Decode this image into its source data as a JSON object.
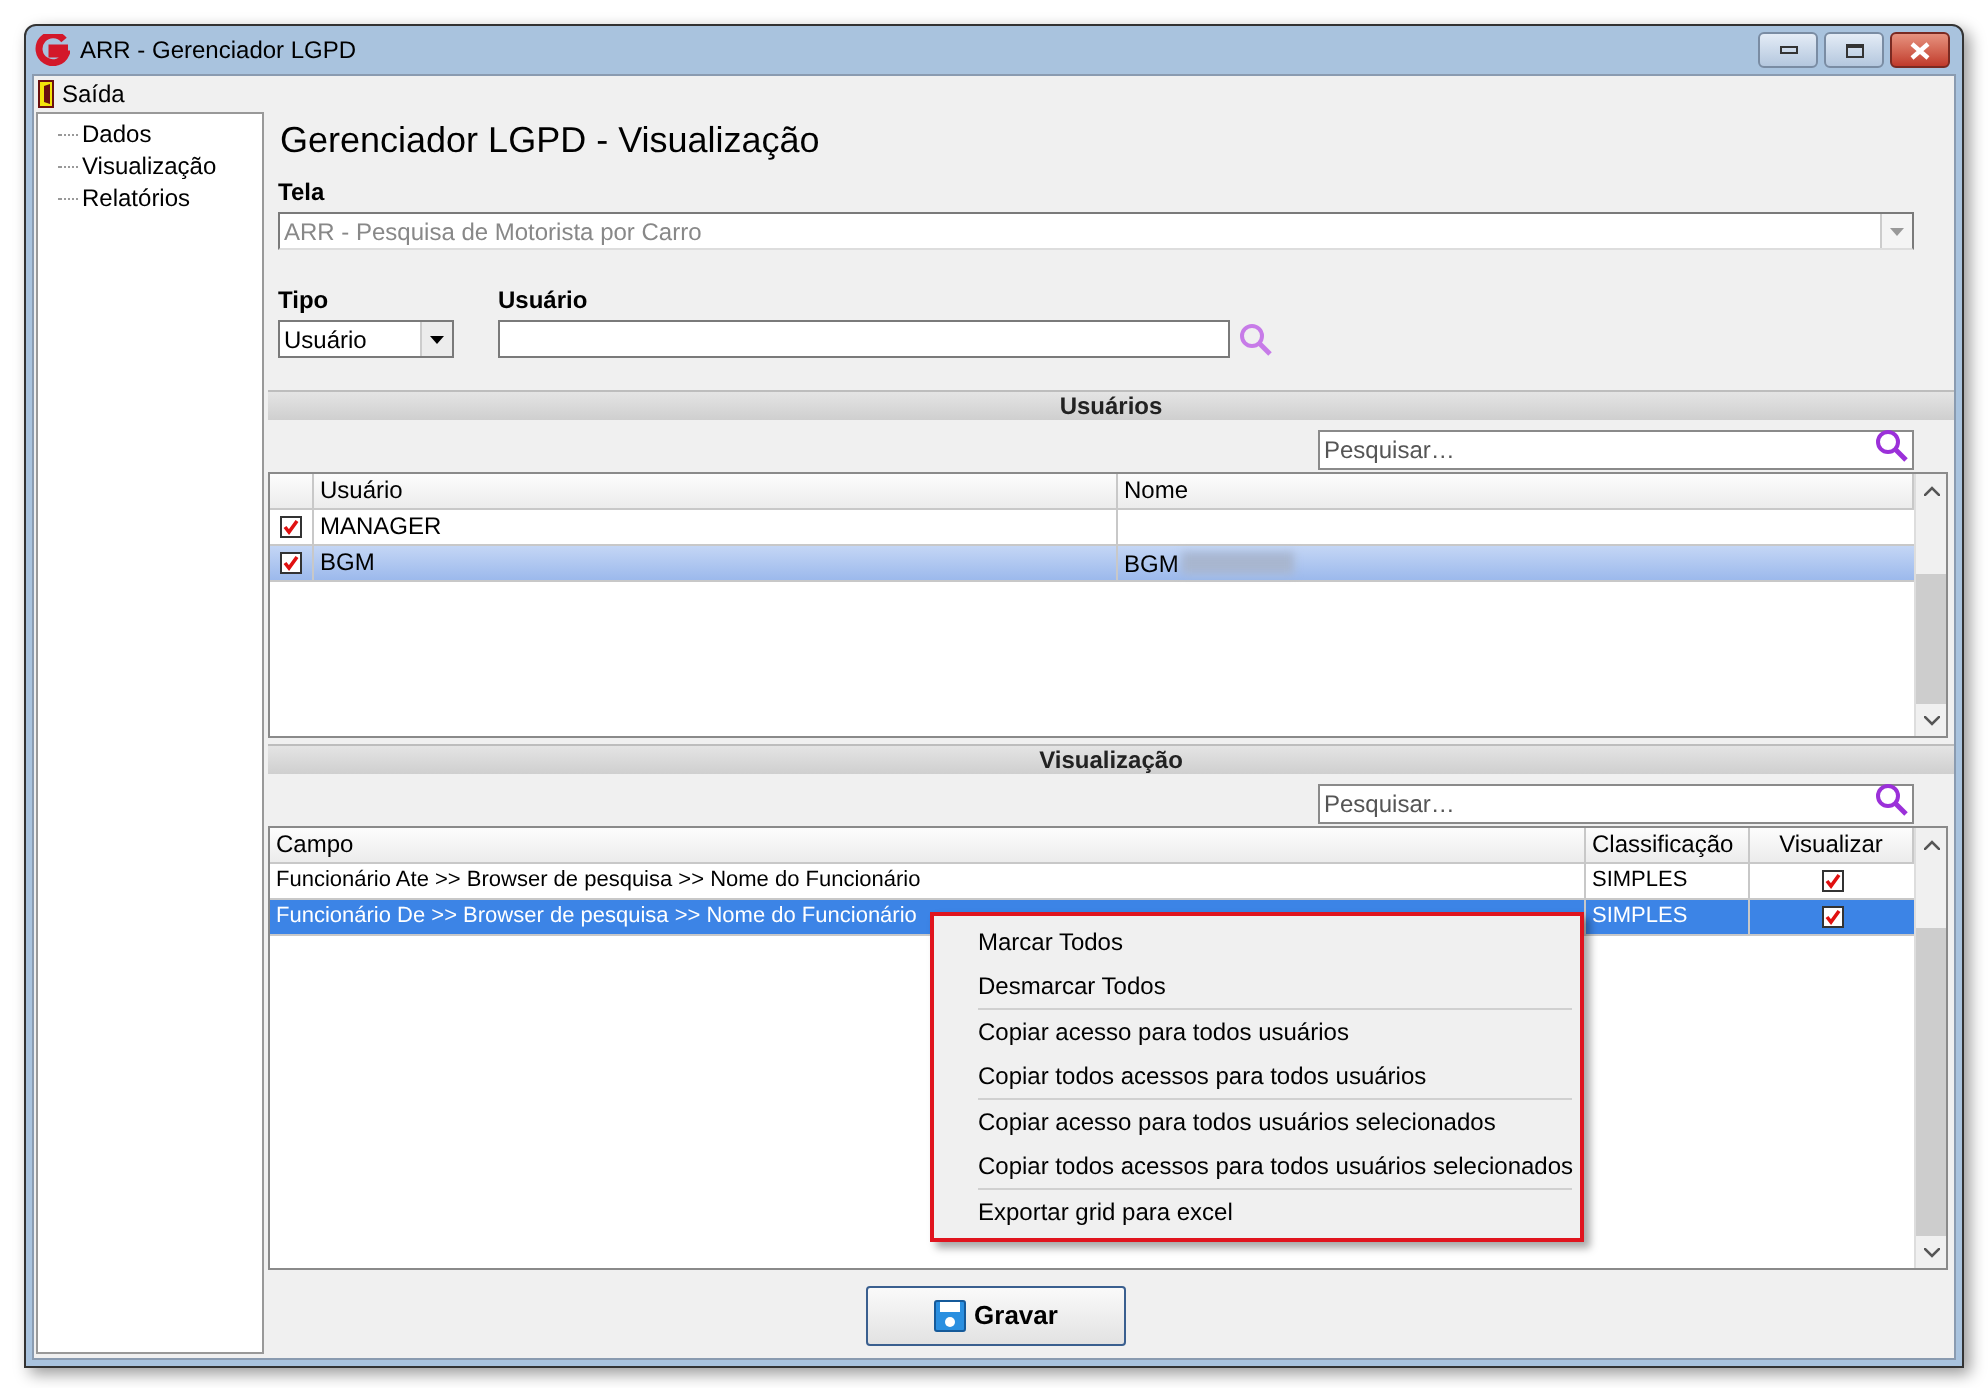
{
  "window": {
    "title": "ARR - Gerenciador LGPD"
  },
  "menu": [
    {
      "label": "Saída"
    }
  ],
  "sidebar": {
    "items": [
      {
        "label": "Dados"
      },
      {
        "label": "Visualização"
      },
      {
        "label": "Relatórios"
      }
    ]
  },
  "heading": "Gerenciador LGPD - Visualização",
  "tela": {
    "label": "Tela",
    "value": "ARR - Pesquisa de Motorista por Carro",
    "disabled": true
  },
  "tipo": {
    "label": "Tipo",
    "value": "Usuário"
  },
  "usuario": {
    "label": "Usuário"
  },
  "users": {
    "title": "Usuários",
    "search": {
      "placeholder": "Pesquisar…"
    },
    "columns": [
      "Usuário",
      "Nome"
    ],
    "rows": [
      {
        "checked": true,
        "usuario": "MANAGER",
        "selected": false
      },
      {
        "checked": true,
        "usuario": "BGM",
        "nome": "BGM",
        "redacted": true,
        "selected": true
      }
    ]
  },
  "visualizacao": {
    "title": "Visualização",
    "search": {
      "placeholder": "Pesquisar…"
    },
    "columns": [
      "Campo",
      "Classificação",
      "Visualizar"
    ],
    "rows": [
      {
        "campo": "Funcionário Ate >> Browser de pesquisa >> Nome do Funcionário",
        "classificacao": "SIMPLES",
        "visualizar": true,
        "selected": false
      },
      {
        "campo": "Funcionário De >> Browser de pesquisa >> Nome do Funcionário",
        "classificacao": "SIMPLES",
        "visualizar": true,
        "selected": true
      }
    ]
  },
  "context_menu": {
    "groups": [
      [
        "Marcar Todos",
        "Desmarcar Todos"
      ],
      [
        "Copiar acesso para todos usuários",
        "Copiar todos acessos para todos usuários"
      ],
      [
        "Copiar acesso para todos usuários selecionados",
        "Copiar todos acessos para todos usuários selecionados"
      ],
      [
        "Exportar grid para excel"
      ]
    ]
  },
  "buttons": [
    {
      "label": "Gravar"
    }
  ]
}
